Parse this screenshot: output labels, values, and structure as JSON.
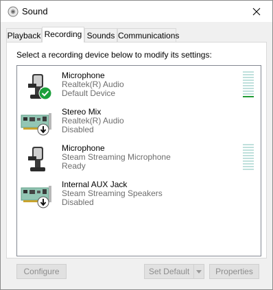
{
  "window": {
    "title": "Sound"
  },
  "tabs": [
    {
      "label": "Playback"
    },
    {
      "label": "Recording"
    },
    {
      "label": "Sounds"
    },
    {
      "label": "Communications"
    }
  ],
  "active_tab": "Recording",
  "instruction": "Select a recording device below to modify its settings:",
  "devices": [
    {
      "name": "Microphone",
      "driver": "Realtek(R) Audio",
      "status": "Default Device",
      "icon": "microphone-icon",
      "badge": "default-check-icon",
      "level_meter": true,
      "level_fraction": 0.1
    },
    {
      "name": "Stereo Mix",
      "driver": "Realtek(R) Audio",
      "status": "Disabled",
      "icon": "sound-card-icon",
      "badge": "disabled-arrow-icon",
      "level_meter": false
    },
    {
      "name": "Microphone",
      "driver": "Steam Streaming Microphone",
      "status": "Ready",
      "icon": "microphone-icon",
      "badge": "",
      "level_meter": true,
      "level_fraction": 0
    },
    {
      "name": "Internal AUX Jack",
      "driver": "Steam Streaming Speakers",
      "status": "Disabled",
      "icon": "sound-card-icon",
      "badge": "disabled-arrow-icon",
      "level_meter": false
    }
  ],
  "buttons": {
    "configure": "Configure",
    "set_default": "Set Default",
    "properties": "Properties"
  },
  "colors": {
    "meter_lit": "#1e9b33",
    "meter_unlit": "#bfe0dc",
    "check_badge": "#1a9f3a",
    "disabled_text": "#8d8d8d"
  }
}
